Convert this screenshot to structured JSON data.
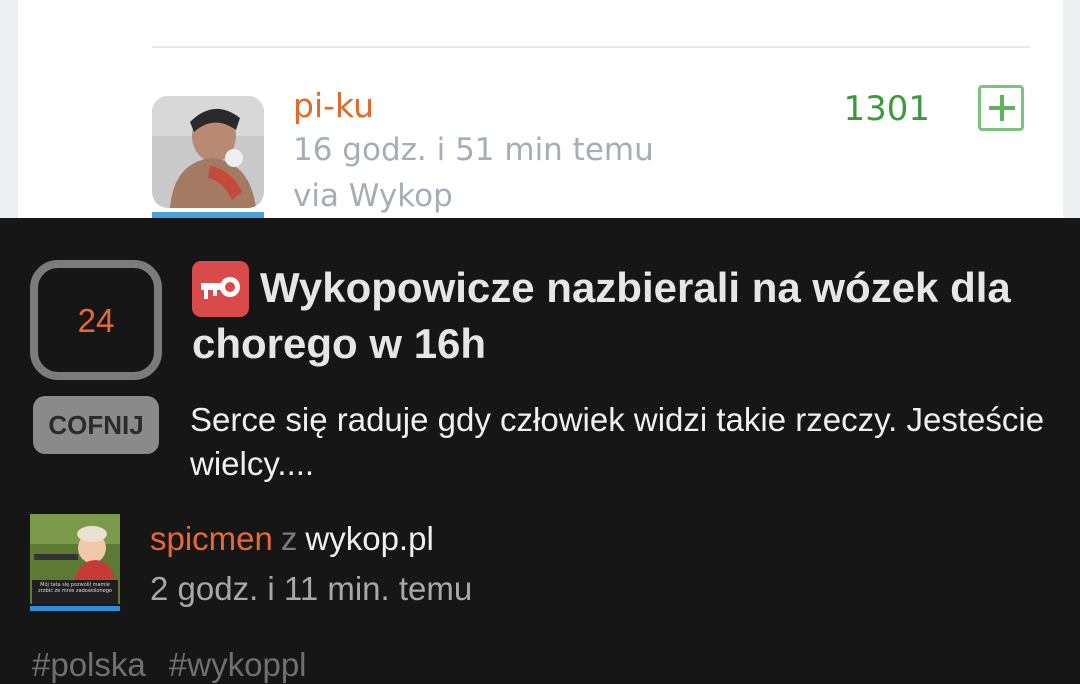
{
  "comment": {
    "username": "pi-ku",
    "time": "16 godz. i 51 min temu",
    "via": "via Wykop",
    "votes": "1301",
    "plus_icon": "plus-square-icon",
    "username_color": "#e06a2a",
    "votes_color": "#3c9a3c"
  },
  "link": {
    "vote_count": "24",
    "undo_label": "COFNIJ",
    "badge_icon": "key-icon",
    "badge_color": "#d94a4a",
    "title": "Wykopowicze nazbierali na wózek dla chorego w 16h",
    "description": "Serce się raduje gdy człowiek widzi takie rzeczy. Jesteście wielcy....",
    "author": "spicmen",
    "from_word": "z",
    "source": "wykop.pl",
    "posted": "2 godz. i 11 min. temu",
    "avatar_caption": "Mój tata się pozwolił mamie zrobić ze mnie zadowolonego",
    "tags": [
      "#polska",
      "#wykoppl"
    ],
    "accent_color": "#e8683a"
  }
}
